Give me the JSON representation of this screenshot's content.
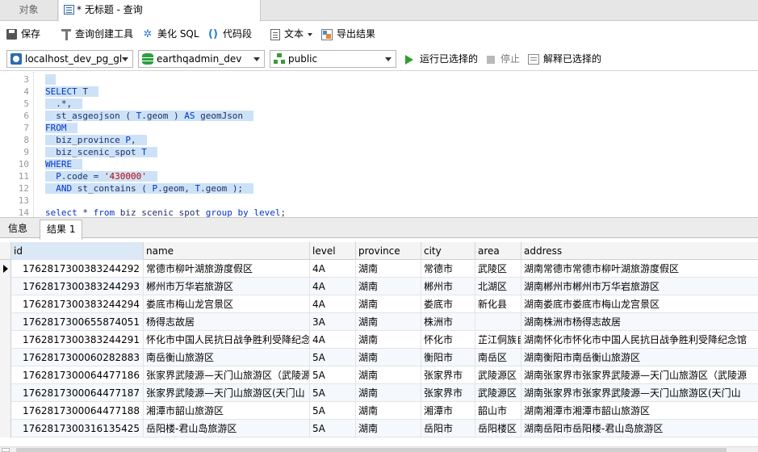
{
  "tabs": {
    "objects": "对象",
    "query": "* 无标题 - 查询"
  },
  "toolbar": {
    "save": "保存",
    "query_builder": "查询创建工具",
    "beautify_sql": "美化 SQL",
    "code_snippet": "代码段",
    "text": "文本",
    "export_results": "导出结果"
  },
  "connection": {
    "server": "localhost_dev_pg_gl",
    "database": "earthqadmin_dev",
    "schema": "public",
    "run_selected": "运行已选择的",
    "stop": "停止",
    "explain_selected": "解释已选择的"
  },
  "editor": {
    "lines": [
      {
        "n": "3",
        "sel": true,
        "parts": [
          {
            "t": "",
            "c": "tx"
          }
        ]
      },
      {
        "n": "4",
        "sel": true,
        "parts": [
          {
            "t": "SELECT ",
            "c": "kw"
          },
          {
            "t": "T",
            "c": "tx"
          }
        ]
      },
      {
        "n": "5",
        "sel": true,
        "parts": [
          {
            "t": "  .*,",
            "c": "tx"
          }
        ]
      },
      {
        "n": "6",
        "sel": true,
        "parts": [
          {
            "t": "  st_asgeojson ( ",
            "c": "tx"
          },
          {
            "t": "T",
            "c": "kw"
          },
          {
            "t": ".geom ) ",
            "c": "tx"
          },
          {
            "t": "AS",
            "c": "kw"
          },
          {
            "t": " geomJson",
            "c": "tx"
          }
        ]
      },
      {
        "n": "7",
        "sel": true,
        "parts": [
          {
            "t": "FROM",
            "c": "kw"
          }
        ]
      },
      {
        "n": "8",
        "sel": true,
        "parts": [
          {
            "t": "  biz_province ",
            "c": "tx"
          },
          {
            "t": "P",
            "c": "kw"
          },
          {
            "t": ",",
            "c": "tx"
          }
        ]
      },
      {
        "n": "9",
        "sel": true,
        "parts": [
          {
            "t": "  biz_scenic_spot ",
            "c": "tx"
          },
          {
            "t": "T",
            "c": "kw"
          }
        ]
      },
      {
        "n": "10",
        "sel": true,
        "parts": [
          {
            "t": "WHERE",
            "c": "kw"
          }
        ]
      },
      {
        "n": "11",
        "sel": true,
        "parts": [
          {
            "t": "  ",
            "c": "tx"
          },
          {
            "t": "P",
            "c": "kw"
          },
          {
            "t": ".code = ",
            "c": "tx"
          },
          {
            "t": "'430000'",
            "c": "str"
          }
        ]
      },
      {
        "n": "12",
        "sel": true,
        "parts": [
          {
            "t": "  AND",
            "c": "kw"
          },
          {
            "t": " st_contains ( ",
            "c": "tx"
          },
          {
            "t": "P",
            "c": "kw"
          },
          {
            "t": ".geom, ",
            "c": "tx"
          },
          {
            "t": "T",
            "c": "kw"
          },
          {
            "t": ".geom );",
            "c": "tx"
          }
        ]
      },
      {
        "n": "13",
        "sel": false,
        "parts": [
          {
            "t": "",
            "c": "tx"
          }
        ]
      },
      {
        "n": "14",
        "sel": false,
        "parts": [
          {
            "t": "select",
            "c": "kw"
          },
          {
            "t": " * ",
            "c": "tx"
          },
          {
            "t": "from",
            "c": "kw"
          },
          {
            "t": " biz_scenic_spot ",
            "c": "tx"
          },
          {
            "t": "group by",
            "c": "kw"
          },
          {
            "t": " ",
            "c": "tx"
          },
          {
            "t": "level",
            "c": "kw"
          },
          {
            "t": ";",
            "c": "tx"
          }
        ]
      }
    ]
  },
  "result_tabs": {
    "info": "信息",
    "result1": "结果 1"
  },
  "grid": {
    "columns": [
      "id",
      "name",
      "level",
      "province",
      "city",
      "area",
      "address"
    ],
    "rows": [
      [
        "176281730038324429​2",
        "常德市柳叶湖旅游度假区",
        "4A",
        "湖南",
        "常德市",
        "武陵区",
        "湖南常德市常德市柳叶湖旅游度假区"
      ],
      [
        "1762817300383244293",
        "郴州市万华岩旅游区",
        "4A",
        "湖南",
        "郴州市",
        "北湖区",
        "湖南郴州市郴州市万华岩旅游区"
      ],
      [
        "1762817300383244294",
        "娄底市梅山龙宫景区",
        "4A",
        "湖南",
        "娄底市",
        "新化县",
        "湖南娄底市娄底市梅山龙宫景区"
      ],
      [
        "1762817300655874051",
        "杨得志故居",
        "3A",
        "湖南",
        "株洲市",
        "",
        "湖南株洲市杨得志故居"
      ],
      [
        "1762817300383244291",
        "怀化市中国人民抗日战争胜利受降纪念",
        "4A",
        "湖南",
        "怀化市",
        "芷江侗族自",
        "湖南怀化市怀化市中国人民抗日战争胜利受降纪念馆"
      ],
      [
        "1762817300060282883",
        "南岳衡山旅游区",
        "5A",
        "湖南",
        "衡阳市",
        "南岳区",
        "湖南衡阳市南岳衡山旅游区"
      ],
      [
        "1762817300064477186",
        "张家界武陵源—天门山旅游区（武陵源",
        "5A",
        "湖南",
        "张家界市",
        "武陵源区",
        "湖南张家界市张家界武陵源—天门山旅游区（武陵源"
      ],
      [
        "1762817300064477187",
        "张家界武陵源—天门山旅游区(天门山",
        "5A",
        "湖南",
        "张家界市",
        "武陵源区",
        "湖南张家界市张家界武陵源—天门山旅游区(天门山"
      ],
      [
        "1762817300064477188",
        "湘潭市韶山旅游区",
        "5A",
        "湖南",
        "湘潭市",
        "韶山市",
        "湖南湘潭市湘潭市韶山旅游区"
      ],
      [
        "1762817300316135425",
        "岳阳楼-君山岛旅游区",
        "5A",
        "湖南",
        "岳阳市",
        "岳阳楼区",
        "湖南岳阳市岳阳楼-君山岛旅游区"
      ]
    ]
  }
}
